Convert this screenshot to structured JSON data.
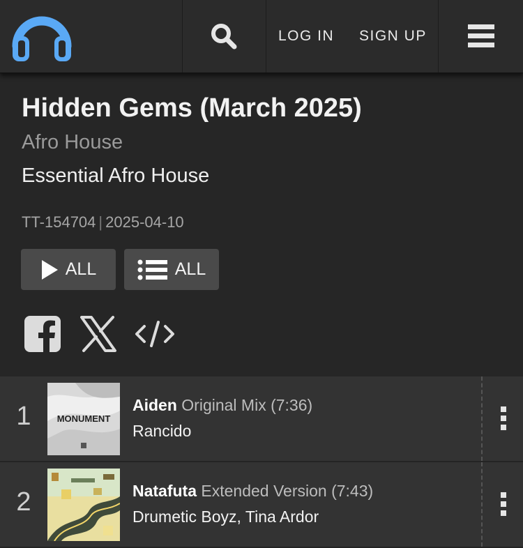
{
  "nav": {
    "logo_icon": "headphones-icon",
    "search_icon": "search-icon",
    "login_label": "LOG IN",
    "signup_label": "SIGN UP",
    "menu_icon": "hamburger-menu-icon",
    "accent_color": "#5aa9f5"
  },
  "chart": {
    "title": "Hidden Gems (March 2025)",
    "genre": "Afro House",
    "label": "Essential Afro House",
    "id": "TT-154704",
    "date": "2025-04-10",
    "play_all_label": "ALL",
    "queue_all_label": "ALL",
    "play_icon": "play-icon",
    "queue_icon": "list-icon"
  },
  "share": {
    "facebook_icon": "facebook-icon",
    "x_icon": "x-icon",
    "embed_icon": "embed-code-icon"
  },
  "tracks": [
    {
      "number": "1",
      "name": "Aiden",
      "mix": "Original Mix (7:36)",
      "artist": "Rancido",
      "art_text": "MONUMENT"
    },
    {
      "number": "2",
      "name": "Natafuta",
      "mix": "Extended Version (7:43)",
      "artist": "Drumetic Boyz, Tina Ardor",
      "art_text": ""
    }
  ]
}
